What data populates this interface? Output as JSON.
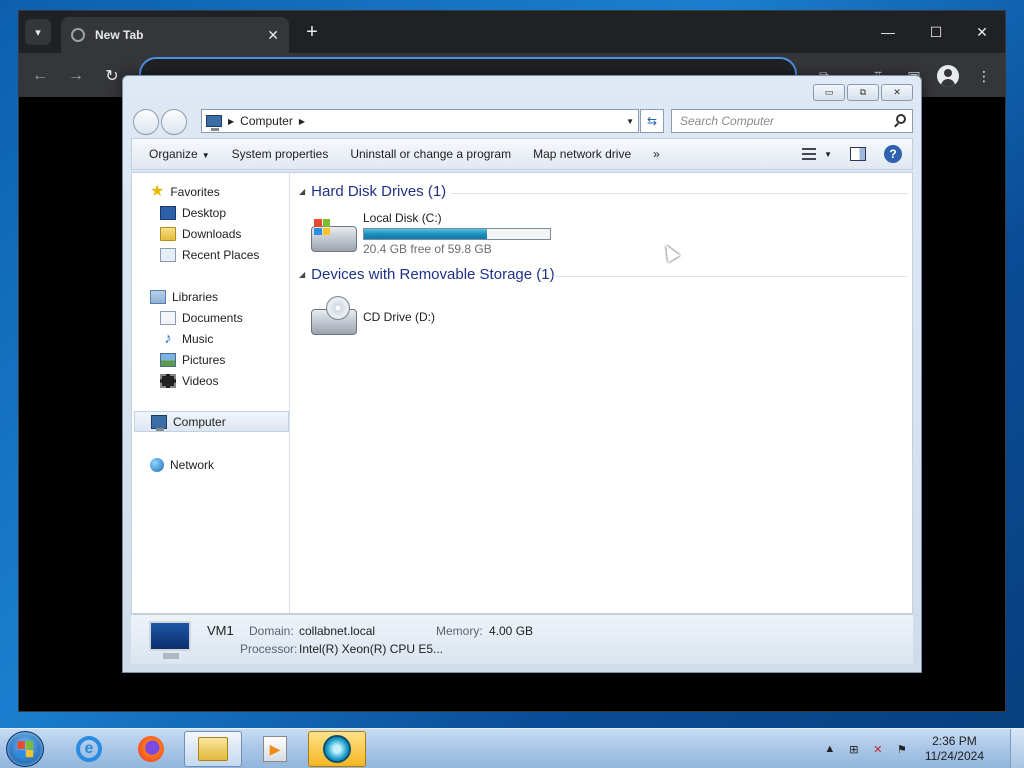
{
  "browser": {
    "tab_title": "New Tab",
    "tab_close": "✕",
    "new_tab": "+",
    "window_controls": {
      "minimize": "—",
      "maximize": "☐",
      "close": "✕"
    },
    "nav": {
      "back": "←",
      "forward": "→",
      "reload": "↻"
    },
    "address_value": ""
  },
  "explorer": {
    "caption": {
      "minimize": "▭",
      "maximize": "⧉",
      "close": "✕"
    },
    "breadcrumb": "Computer",
    "search_placeholder": "Search Computer",
    "toolbar": {
      "organize": "Organize",
      "system_properties": "System properties",
      "uninstall": "Uninstall or change a program",
      "map_drive": "Map network drive",
      "more": "»",
      "help": "?"
    },
    "sidebar": {
      "favorites": "Favorites",
      "desktop": "Desktop",
      "downloads": "Downloads",
      "recent_places": "Recent Places",
      "libraries": "Libraries",
      "documents": "Documents",
      "music": "Music",
      "pictures": "Pictures",
      "videos": "Videos",
      "computer": "Computer",
      "network": "Network"
    },
    "groups": {
      "hard_disk": "Hard Disk Drives (1)",
      "removable": "Devices with Removable Storage (1)"
    },
    "drives": {
      "c_name": "Local Disk (C:)",
      "c_free": "20.4 GB free of 59.8 GB",
      "c_used_fraction": 0.66,
      "d_name": "CD Drive (D:)"
    },
    "details": {
      "name": "VM1",
      "domain_label": "Domain:",
      "domain_value": "collabnet.local",
      "memory_label": "Memory:",
      "memory_value": "4.00 GB",
      "processor_label": "Processor:",
      "processor_value": "Intel(R) Xeon(R) CPU E5..."
    }
  },
  "taskbar": {
    "time": "2:36 PM",
    "date": "11/24/2024",
    "tray_up": "▲"
  }
}
